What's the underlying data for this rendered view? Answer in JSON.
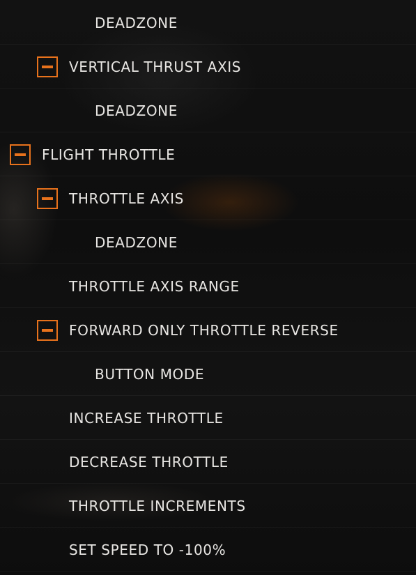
{
  "bindings_tree": {
    "accent_color": "#e8721c",
    "text_color": "#e8e6e3",
    "collapse_icon": "minus-icon",
    "rows": [
      {
        "label": "DEADZONE",
        "level": 2,
        "has_toggle": false,
        "expanded": null
      },
      {
        "label": "VERTICAL THRUST AXIS",
        "level": 1,
        "has_toggle": true,
        "expanded": true
      },
      {
        "label": "DEADZONE",
        "level": 2,
        "has_toggle": false,
        "expanded": null
      },
      {
        "label": "FLIGHT THROTTLE",
        "level": 0,
        "has_toggle": true,
        "expanded": true
      },
      {
        "label": "THROTTLE AXIS",
        "level": 1,
        "has_toggle": true,
        "expanded": true
      },
      {
        "label": "DEADZONE",
        "level": 2,
        "has_toggle": false,
        "expanded": null
      },
      {
        "label": "THROTTLE AXIS RANGE",
        "level": 1,
        "has_toggle": false,
        "expanded": null
      },
      {
        "label": "FORWARD ONLY THROTTLE REVERSE",
        "level": 1,
        "has_toggle": true,
        "expanded": true
      },
      {
        "label": "BUTTON MODE",
        "level": 2,
        "has_toggle": false,
        "expanded": null
      },
      {
        "label": "INCREASE THROTTLE",
        "level": 1,
        "has_toggle": false,
        "expanded": null
      },
      {
        "label": "DECREASE THROTTLE",
        "level": 1,
        "has_toggle": false,
        "expanded": null
      },
      {
        "label": "THROTTLE INCREMENTS",
        "level": 1,
        "has_toggle": false,
        "expanded": null
      },
      {
        "label": "SET SPEED TO -100%",
        "level": 1,
        "has_toggle": false,
        "expanded": null
      }
    ]
  }
}
